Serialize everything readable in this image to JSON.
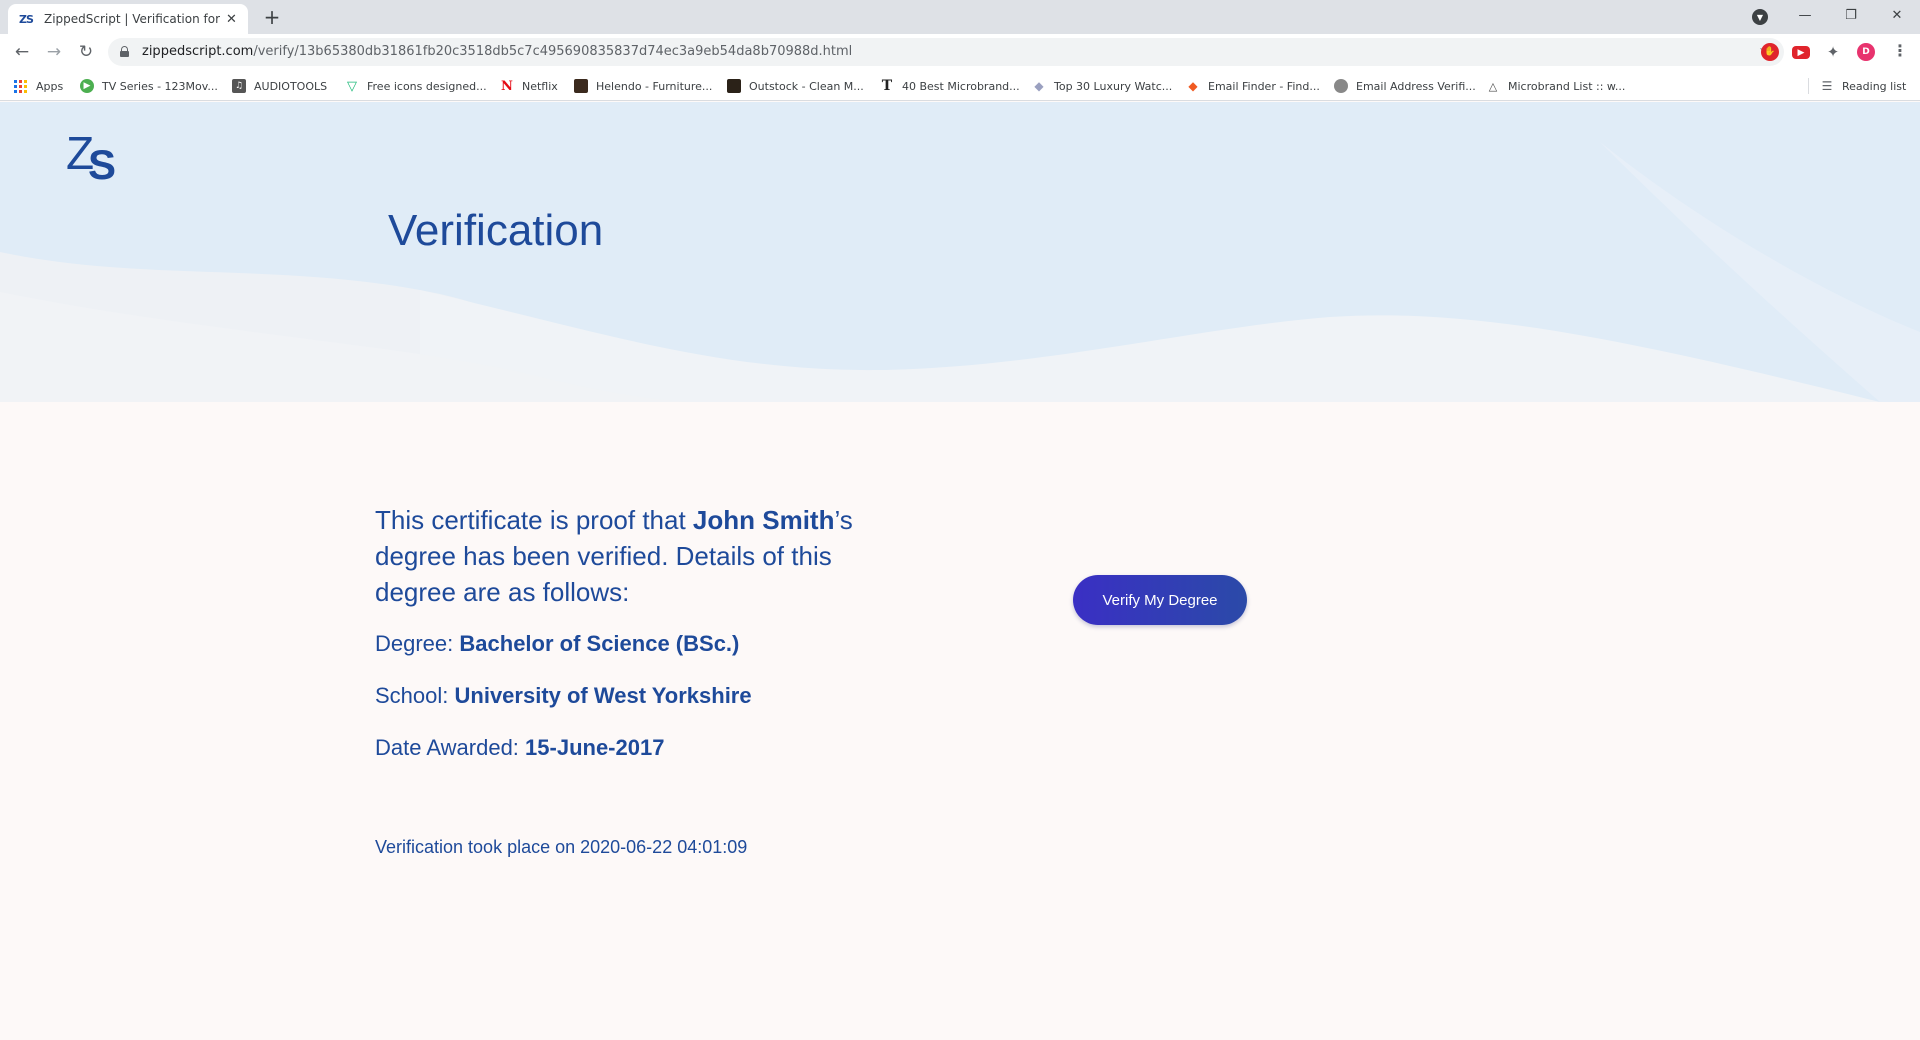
{
  "browser": {
    "tab_title": "ZippedScript | Verification for Jer",
    "tab_favicon": "ZS",
    "new_tab": "+",
    "url_domain": "zippedscript.com",
    "url_path": "/verify/13b65380db31861fb20c3518db5c7c495690835837d74ec3a9eb54da8b70988d.html",
    "profile_initial": "D",
    "bookmarks": [
      {
        "label": "Apps",
        "icon": "apps-grid-icon"
      },
      {
        "label": "TV Series - 123Mov...",
        "icon": "play-icon"
      },
      {
        "label": "AUDIOTOOLS",
        "icon": "audiotools-icon"
      },
      {
        "label": "Free icons designed...",
        "icon": "freepik-icon"
      },
      {
        "label": "Netflix",
        "icon": "netflix-icon"
      },
      {
        "label": "Helendo - Furniture...",
        "icon": "helendo-icon"
      },
      {
        "label": "Outstock - Clean M...",
        "icon": "outstock-icon"
      },
      {
        "label": "40 Best Microbrand...",
        "icon": "t-icon"
      },
      {
        "label": "Top 30 Luxury Watc...",
        "icon": "diamond-icon"
      },
      {
        "label": "Email Finder - Find...",
        "icon": "email-finder-icon"
      },
      {
        "label": "Email Address Verifi...",
        "icon": "email-verify-icon"
      },
      {
        "label": "Microbrand List :: w...",
        "icon": "microbrand-icon"
      }
    ],
    "reading_list": "Reading list"
  },
  "hero": {
    "logo_z": "Z",
    "logo_s": "S",
    "title": "Verification"
  },
  "certificate": {
    "intro_prefix": "This certificate is proof that ",
    "name": "John Smith",
    "intro_suffix": "’s degree has been verified. Details of this degree are as follows:",
    "degree_label": "Degree: ",
    "degree_value": "Bachelor of Science (BSc.)",
    "school_label": "School: ",
    "school_value": "University of West Yorkshire",
    "date_label": "Date Awarded: ",
    "date_value": "15-June-2017",
    "timestamp": "Verification took place on 2020-06-22 04:01:09"
  },
  "actions": {
    "verify_button": "Verify My Degree"
  },
  "colors": {
    "brand_blue": "#1e4a9a",
    "button_start": "#3a2fc4",
    "button_end": "#2b4aa8",
    "hero_bg": "#e0ecf7",
    "page_bg": "#fdf9f8"
  }
}
